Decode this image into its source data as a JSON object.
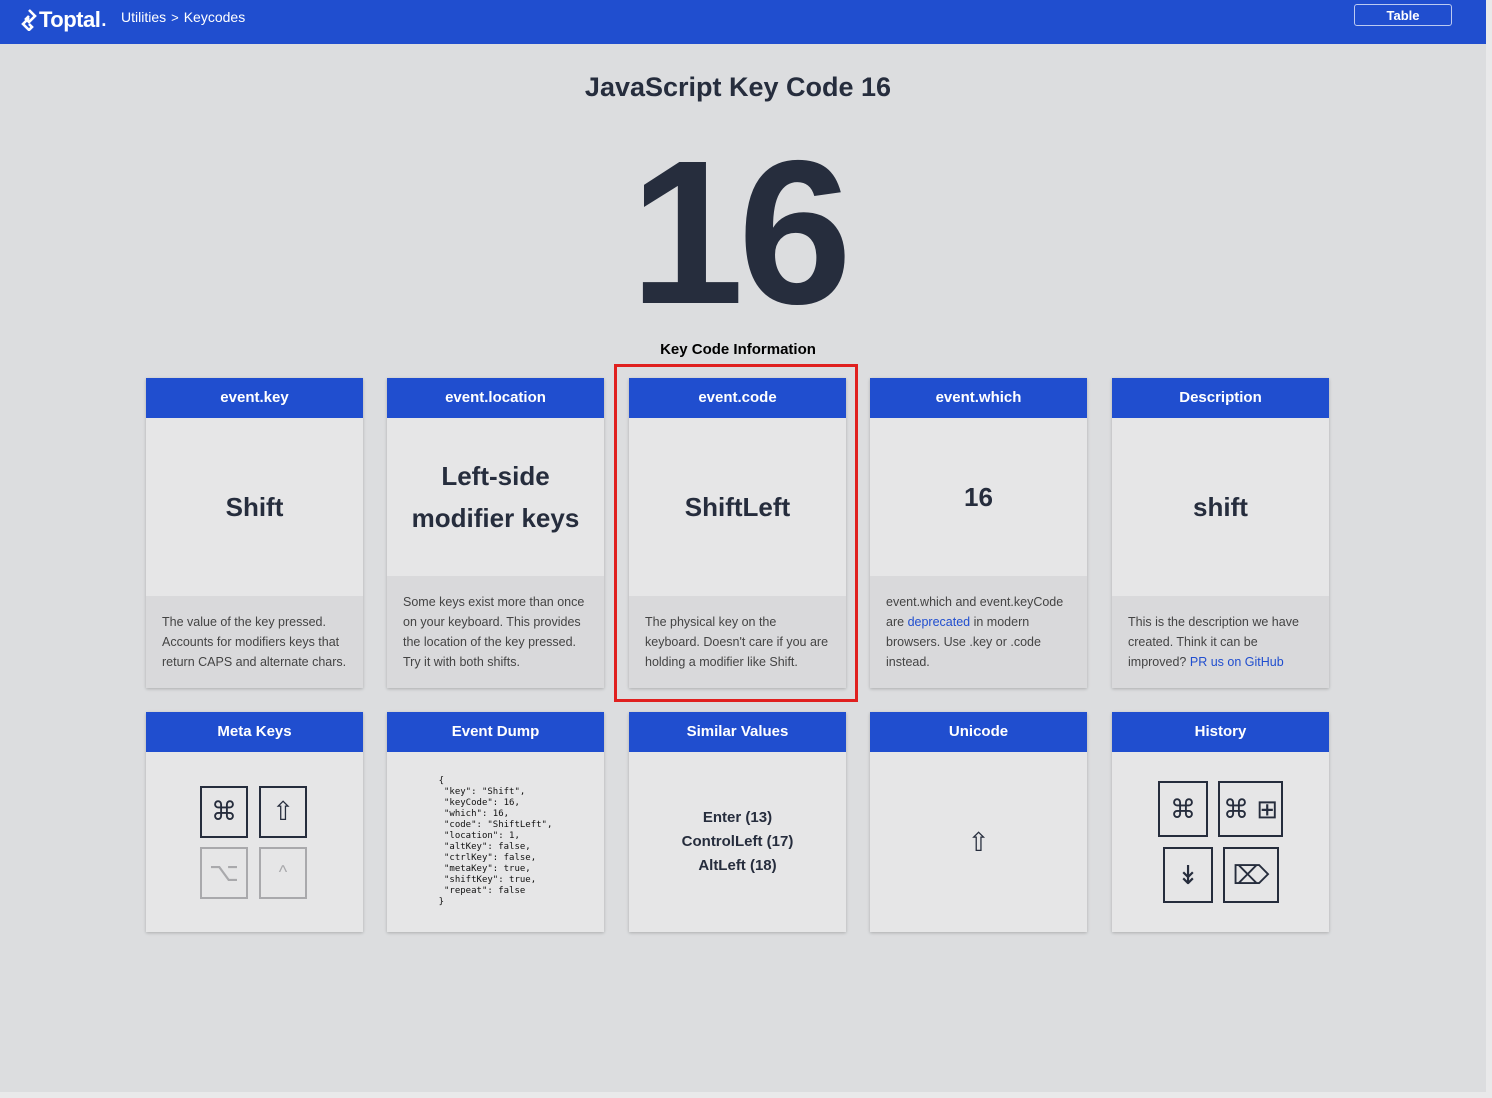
{
  "header": {
    "logo_text": "Toptal",
    "breadcrumb": [
      "Utilities",
      "Keycodes"
    ],
    "breadcrumb_separator": ">",
    "table_button": "Table"
  },
  "title": "JavaScript Key Code 16",
  "key_code": "16",
  "section_label": "Key Code Information",
  "cards": {
    "key": {
      "header": "event.key",
      "value": "Shift",
      "description": "The value of the key pressed. Accounts for modifiers keys that return CAPS and alternate chars."
    },
    "location": {
      "header": "event.location",
      "value": "Left-side modifier keys",
      "description": "Some keys exist more than once on your keyboard. This provides the location of the key pressed. Try it with both shifts."
    },
    "code": {
      "header": "event.code",
      "value": "ShiftLeft",
      "description": "The physical key on the keyboard. Doesn't care if you are holding a modifier like Shift."
    },
    "which": {
      "header": "event.which",
      "value": "16",
      "desc_part1": "event.which and event.keyCode are",
      "desc_link": "deprecated",
      "desc_part2": "in modern browsers. Use .key or .code instead."
    },
    "description": {
      "header": "Description",
      "value": "shift",
      "desc_part1": "This is the description we have created. Think it can be improved?",
      "desc_link": "PR us on GitHub"
    }
  },
  "meta_keys": {
    "header": "Meta Keys",
    "keys": [
      {
        "glyph": "⌘",
        "icon": "command-icon",
        "active": true
      },
      {
        "glyph": "⇧",
        "icon": "shift-icon",
        "active": true
      },
      {
        "glyph": "⌥",
        "icon": "option-icon",
        "active": false
      },
      {
        "glyph": "^",
        "icon": "control-icon",
        "active": false
      }
    ]
  },
  "event_dump": {
    "header": "Event Dump",
    "text": "{\n \"key\": \"Shift\",\n \"keyCode\": 16,\n \"which\": 16,\n \"code\": \"ShiftLeft\",\n \"location\": 1,\n \"altKey\": false,\n \"ctrlKey\": false,\n \"metaKey\": true,\n \"shiftKey\": true,\n \"repeat\": false\n}"
  },
  "similar_values": {
    "header": "Similar Values",
    "items": [
      "Enter (13)",
      "ControlLeft (17)",
      "AltLeft (18)"
    ]
  },
  "unicode": {
    "header": "Unicode",
    "glyph": "⇧"
  },
  "history": {
    "header": "History",
    "keys": [
      {
        "glyph": "⌘",
        "icon": "command-icon"
      },
      {
        "glyph": "⌘ ⊞",
        "icon": "command-windows-icon"
      },
      {
        "glyph": "↡",
        "icon": "down-arrow-icon"
      },
      {
        "glyph": "⌦",
        "icon": "delete-icon"
      }
    ]
  },
  "colors": {
    "brand": "#204ecf",
    "highlight": "#e0201f",
    "background": "#dcdddf"
  }
}
